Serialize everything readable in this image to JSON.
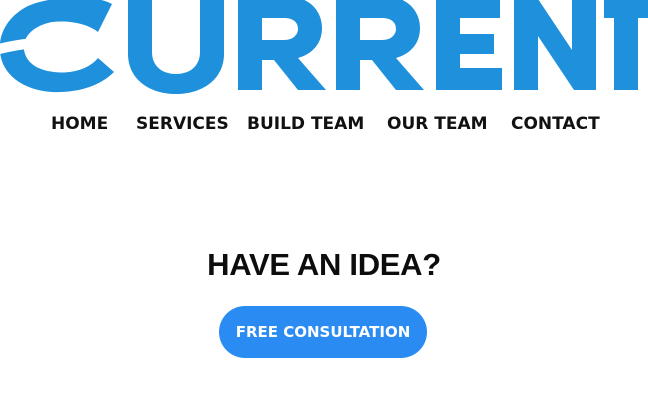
{
  "logo": {
    "text": "CURRENT",
    "color": "#1e90dc"
  },
  "nav": {
    "items": [
      {
        "label": "HOME"
      },
      {
        "label": "SERVICES"
      },
      {
        "label": "BUILD TEAM"
      },
      {
        "label": "OUR TEAM"
      },
      {
        "label": "CONTACT"
      }
    ]
  },
  "hero": {
    "headline": "HAVE AN IDEA?",
    "cta_label": "FREE CONSULTATION",
    "cta_color": "#2a8bf2"
  }
}
